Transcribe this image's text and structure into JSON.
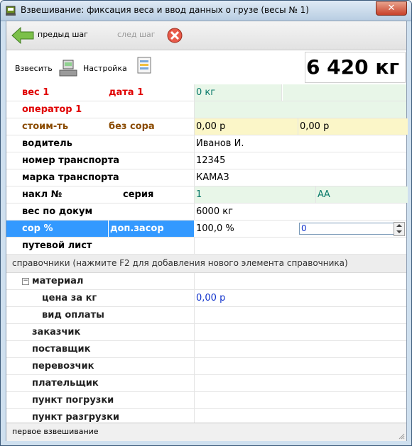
{
  "window": {
    "title": "Взвешивание: фиксация веса и ввод данных о грузе (весы № 1)",
    "close_glyph": "✕"
  },
  "toolbar": {
    "back_label": "предыд шаг",
    "next_label": "след шаг",
    "weigh_label": "Взвесить",
    "settings_label": "Настройка"
  },
  "weight_display": "6 420 кг",
  "rows": {
    "r1": {
      "a": "вес 1",
      "b": "дата 1",
      "c": "0 кг",
      "d": ""
    },
    "r2": {
      "a": "оператор 1"
    },
    "r3": {
      "a": "стоим-ть",
      "b": "без сора",
      "c": "0,00 р",
      "d": "0,00 р"
    },
    "r4": {
      "a": "водитель",
      "c": "Иванов И."
    },
    "r5": {
      "a": "номер транспорта",
      "c": "12345"
    },
    "r6": {
      "a": "марка транспорта",
      "c": "КАМАЗ"
    },
    "r7": {
      "a": "накл №",
      "b": "серия",
      "c": "1",
      "d": "АА"
    },
    "r8": {
      "a": "вес по докум",
      "c": "6000 кг"
    },
    "r9": {
      "a": "сор %",
      "b": "доп.засор",
      "c": "100,0 %",
      "d": "0"
    },
    "r10": {
      "a": "путевой лист"
    }
  },
  "reference_header": "справочники (нажмите F2 для добавления нового элемента справочника)",
  "reference": {
    "material": "материал",
    "expander": "−",
    "price_per_kg": "цена за кг",
    "price_value": "0,00 р",
    "payment_type": "вид оплаты",
    "customer": "заказчик",
    "supplier": "поставщик",
    "carrier": "перевозчик",
    "payer": "плательщик",
    "loading_point": "пункт погрузки",
    "unloading_point": "пункт разгрузки"
  },
  "status": "первое взвешивание",
  "colors": {
    "selection": "#3399ff",
    "red_label": "#e00000",
    "brown_label": "#8a4a00",
    "blue_value": "#1133cc",
    "teal_value": "#0a7a6a",
    "green_row": "#e8f6e8",
    "yellow_row": "#fbf6c8"
  }
}
